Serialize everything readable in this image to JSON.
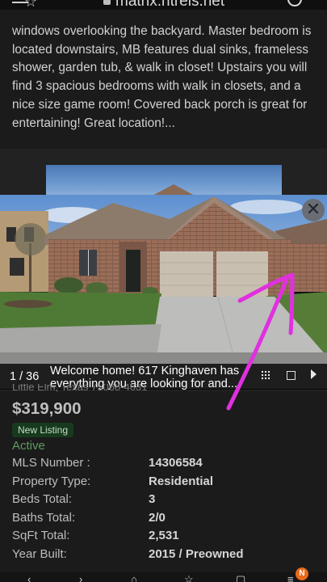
{
  "browser": {
    "url": "matrix.ntreis.net",
    "icons": [
      "star-icon",
      "lock-icon",
      "tabs-circle-icon",
      "menu-icon"
    ]
  },
  "listing": {
    "description": "windows overlooking the backyard. Master bedroom is located downstairs, MB features dual sinks, frameless shower, garden tub, & walk in closet! Upstairs you will find 3 spacious bedrooms with walk in closets, and a nice size game room! Covered back porch is great for entertaining! Great location!...",
    "address": "Little Elm, Texas 75068-4631",
    "price": "$319,900",
    "badge": "New Listing",
    "status": "Active",
    "details": [
      {
        "label": "MLS Number :",
        "value": "14306584"
      },
      {
        "label": "Property Type:",
        "value": "Residential"
      },
      {
        "label": "Beds Total:",
        "value": "3"
      },
      {
        "label": "Baths Total:",
        "value": "2/0"
      },
      {
        "label": "SqFt Total:",
        "value": "2,531"
      },
      {
        "label": "Year Built:",
        "value": "2015 / Preowned"
      }
    ]
  },
  "viewer": {
    "counter": "1 / 36",
    "caption": "Welcome home! 617 Kinghaven has everything you are looking for and...",
    "close_glyph": "✕"
  },
  "bottom_nav": {
    "notification_badge": "N"
  },
  "colors": {
    "background": "#1b1b1b",
    "status_green": "#5f9b5f",
    "badge_bg": "#163a1e",
    "annotation": "#e030e0"
  }
}
